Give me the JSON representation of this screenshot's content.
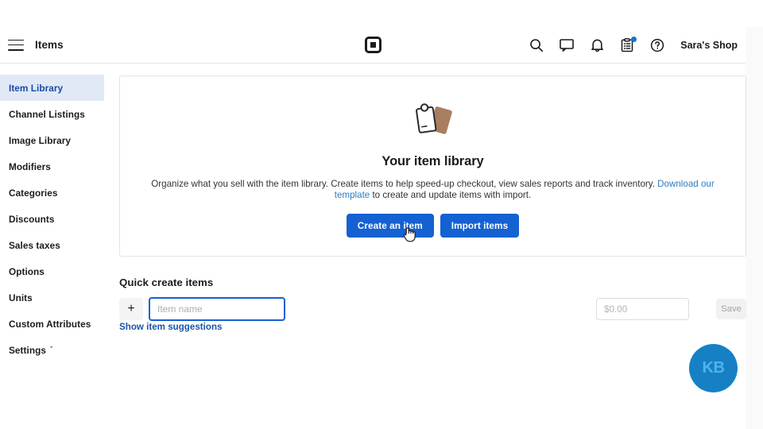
{
  "header": {
    "menu_icon": "hamburger-icon",
    "title": "Items",
    "logo": "square-logo",
    "icons": [
      {
        "name": "search-icon"
      },
      {
        "name": "messages-icon"
      },
      {
        "name": "notifications-bell-icon"
      },
      {
        "name": "clipboard-icon",
        "badge": true
      },
      {
        "name": "help-icon"
      }
    ],
    "shop_name": "Sara's Shop"
  },
  "sidebar": {
    "items": [
      {
        "label": "Item Library",
        "active": true
      },
      {
        "label": "Channel Listings",
        "active": false
      },
      {
        "label": "Image Library",
        "active": false
      },
      {
        "label": "Modifiers",
        "active": false
      },
      {
        "label": "Categories",
        "active": false
      },
      {
        "label": "Discounts",
        "active": false
      },
      {
        "label": "Sales taxes",
        "active": false
      },
      {
        "label": "Options",
        "active": false
      },
      {
        "label": "Units",
        "active": false
      },
      {
        "label": "Custom Attributes",
        "active": false
      },
      {
        "label": "Settings",
        "active": false,
        "chevron": "ˇ"
      }
    ]
  },
  "empty_state": {
    "icon": "price-tags-icon",
    "title": "Your item library",
    "description_part1": "Organize what you sell with the item library. Create items to help speed-up checkout, view sales reports and track inventory. ",
    "link_text": "Download our template",
    "description_part2": " to create and update items with import.",
    "primary_button": "Create an item",
    "secondary_button": "Import items",
    "primary_color": "#1461d2"
  },
  "quick_create": {
    "title": "Quick create items",
    "add_icon": "plus-icon",
    "item_name_placeholder": "Item name",
    "item_name_value": "",
    "price_placeholder": "$0.00",
    "price_value": "",
    "save_label": "Save",
    "suggestions_link": "Show item suggestions"
  },
  "avatar": {
    "initials": "KB",
    "bg_color": "#1581c4",
    "text_color": "#4fb3ef"
  }
}
